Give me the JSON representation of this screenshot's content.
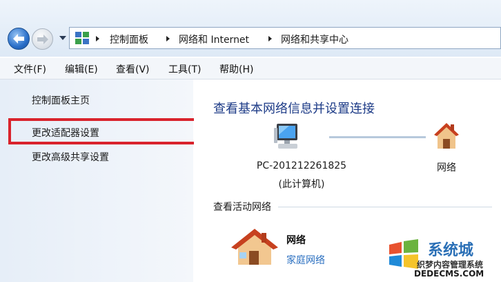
{
  "address_bar": {
    "breadcrumbs": [
      "控制面板",
      "网络和 Internet",
      "网络和共享中心"
    ]
  },
  "menu": [
    "文件(F)",
    "编辑(E)",
    "查看(V)",
    "工具(T)",
    "帮助(H)"
  ],
  "sidebar": {
    "items": [
      {
        "label": "控制面板主页"
      },
      {
        "label": "更改适配器设置"
      },
      {
        "label": "更改高级共享设置"
      }
    ]
  },
  "main": {
    "heading": "查看基本网络信息并设置连接",
    "computer": {
      "name": "PC-201212261825",
      "sub": "(此计算机)"
    },
    "network_label": "网络",
    "active_section_title": "查看活动网络",
    "active_network": {
      "name": "网络",
      "type": "家庭网络"
    }
  },
  "watermark": {
    "big": "系统城",
    "small": "织梦内容管理系统",
    "url": "DEDECMS.COM"
  },
  "colors": {
    "highlight_box": "#d9232c",
    "heading": "#1d3b87",
    "link": "#2a6fc0"
  }
}
